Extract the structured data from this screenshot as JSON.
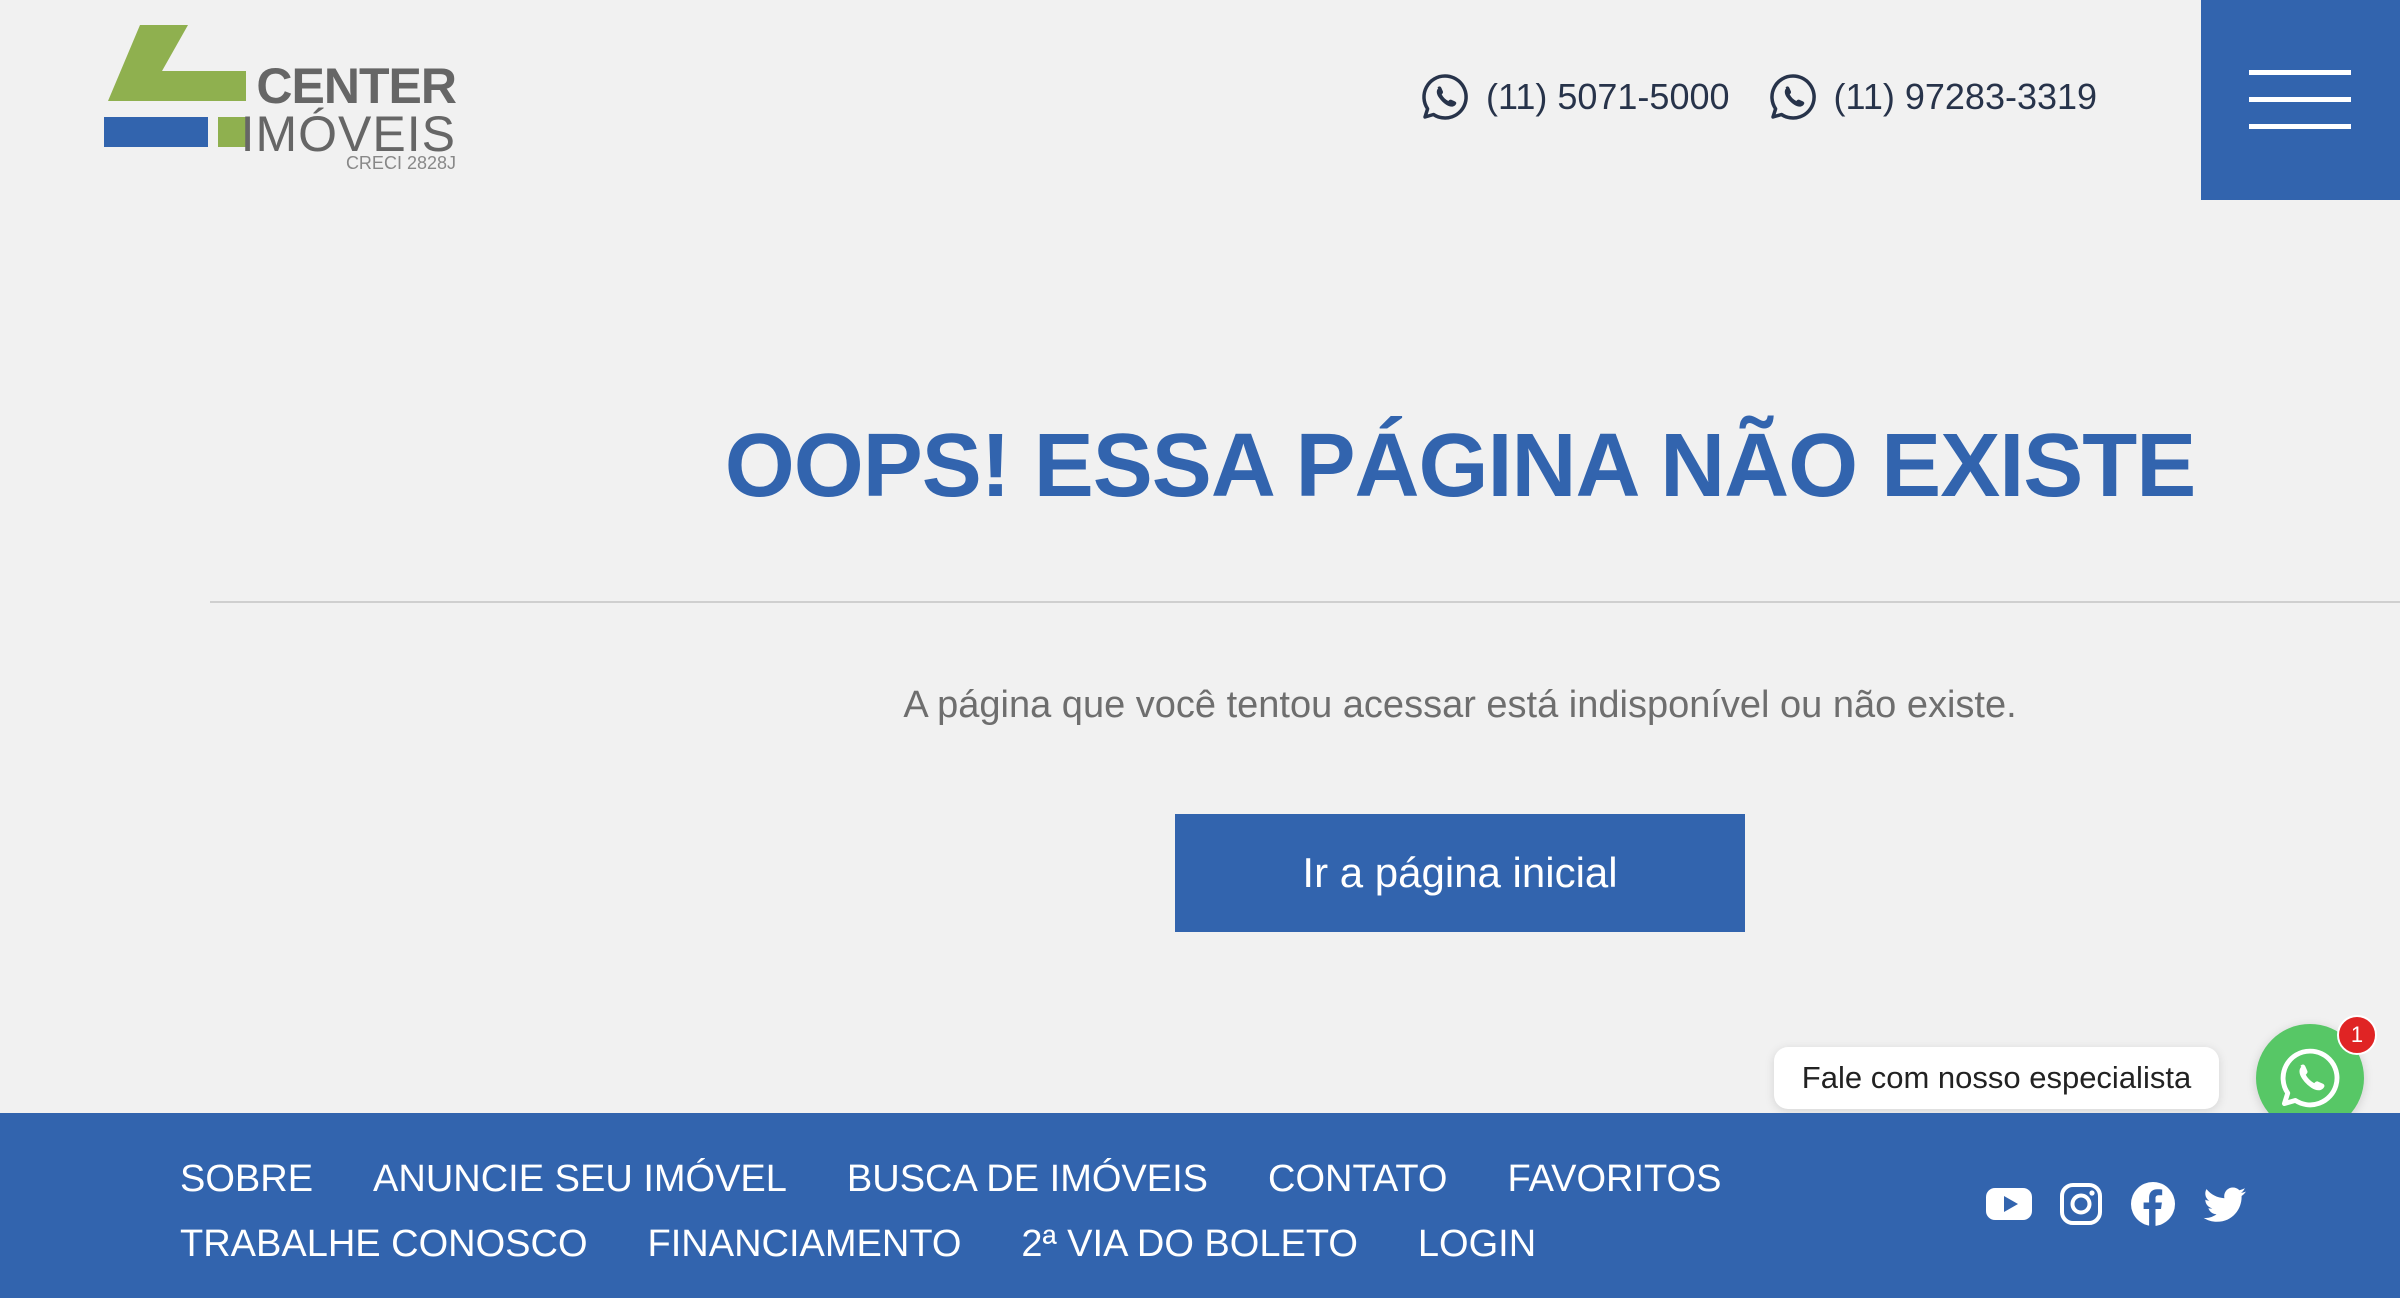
{
  "header": {
    "logo": {
      "line1": "CENTER",
      "line2": "IMÓVEIS",
      "creci": "CRECI 2828J"
    },
    "phones": [
      {
        "number": "(11) 5071-5000",
        "icon": "whatsapp-icon"
      },
      {
        "number": "(11) 97283-3319",
        "icon": "whatsapp-icon"
      }
    ],
    "menu_icon": "hamburger-menu-icon"
  },
  "main": {
    "title": "OOPS! ESSA PÁGINA NÃO EXISTE",
    "message": "A página que você tentou acessar está indisponível ou não existe.",
    "button_label": "Ir a página inicial"
  },
  "chat": {
    "label": "Fale com nosso especialista",
    "badge_count": "1",
    "icon": "whatsapp-icon"
  },
  "footer": {
    "nav_rows": [
      [
        "SOBRE",
        "ANUNCIE SEU IMÓVEL",
        "BUSCA DE IMÓVEIS",
        "CONTATO",
        "FAVORITOS"
      ],
      [
        "TRABALHE CONOSCO",
        "FINANCIAMENTO",
        "2ª VIA DO BOLETO",
        "LOGIN"
      ]
    ],
    "social_icons": [
      "youtube-icon",
      "instagram-icon",
      "facebook-icon",
      "twitter-icon"
    ]
  },
  "colors": {
    "brand_blue": "#3264ae",
    "logo_green": "#8fb04f",
    "background": "#f1f1f1",
    "whatsapp_green": "#57c766",
    "badge_red": "#e02424"
  }
}
